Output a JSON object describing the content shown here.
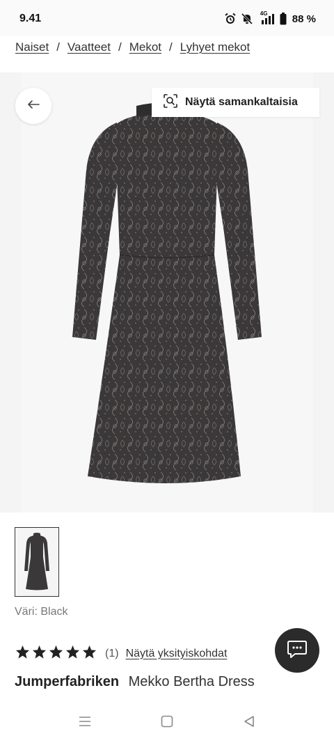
{
  "status_bar": {
    "time": "9.41",
    "network": "4G",
    "battery": "88 %"
  },
  "breadcrumb": {
    "items": [
      "Naiset",
      "Vaatteet",
      "Mekot",
      "Lyhyet mekot"
    ],
    "separator": "/"
  },
  "gallery": {
    "back_icon": "arrow-left-icon",
    "similar_button_label": "Näytä samankaltaisia",
    "similar_icon": "visual-search-icon"
  },
  "product": {
    "color_label": "Väri: Black",
    "rating": 5,
    "rating_max": 5,
    "review_count": "(1)",
    "details_link": "Näytä yksityiskohdat",
    "brand": "Jumperfabriken",
    "name": "Mekko Bertha Dress"
  },
  "chat": {
    "icon": "chat-bubble-icon"
  },
  "colors": {
    "dress_base": "#3a3838",
    "dress_pattern": "#8a8482",
    "star": "#222222",
    "chat_bg": "#2b2b2b"
  }
}
